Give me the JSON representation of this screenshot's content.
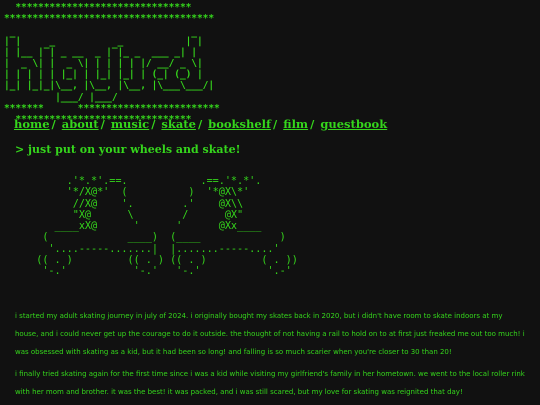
{
  "logo_ascii": "  *******************************\n*************************************\n\n|‾|     _           _           |‾|\n| |__ |‾| _ __  _ |‾|_ _  ___ _| |\n|  _ \\| |  _ \\| | | | | |/ __/ _ \\|\n| | | | | |_| | |_| |_| | (_| (_) |\n|_| |_|_|\\__, |\\__, |\\__, |\\___\\___/|\n         |___/ |___/\n*******      *************************\n  *******************************",
  "nav": {
    "items": [
      {
        "label": "home"
      },
      {
        "label": "about"
      },
      {
        "label": "music"
      },
      {
        "label": "skate"
      },
      {
        "label": "bookshelf"
      },
      {
        "label": "film"
      },
      {
        "label": "guestbook"
      }
    ],
    "separator": "/"
  },
  "tagline": "> just put on your wheels and skate!",
  "skates_ascii": "        .'*.*'.==.            .==.'*.*'.\n        '*/X@*'  (          )  '*@X\\*'\n         //X@    '.        .'    @X\\\\\n         \"X@      \\        /      @X\"\n      ____xX@      '      '      @Xx____\n    (             ____)  (____             )\n     '....-----.......|  |.......-----....'\n   (( . )         (( . ) (( . )         ( . ))\n    '-.'           '-.'   '-.'           '.-'",
  "paragraphs": [
    "i started my adult skating journey in july of 2024. i originally bought my skates back in 2020, but i didn't have room to skate indoors at my house, and i could never get up the courage to do it outside. the thought of not having a rail to hold on to at first just freaked me out too much! i was obsessed with skating as a kid, but it had been so long! and falling is so much scarier when you're closer to 30 than 20!",
    "i finally tried skating again for the first time since i was a kid while visiting my girlfriend's family in her hometown. we went to the local roller rink with her mom and brother. it was the best! it was packed, and i was still scared, but my love for skating was reignited that day!"
  ],
  "colors": {
    "background": "#111111",
    "text": "#35d61c"
  }
}
